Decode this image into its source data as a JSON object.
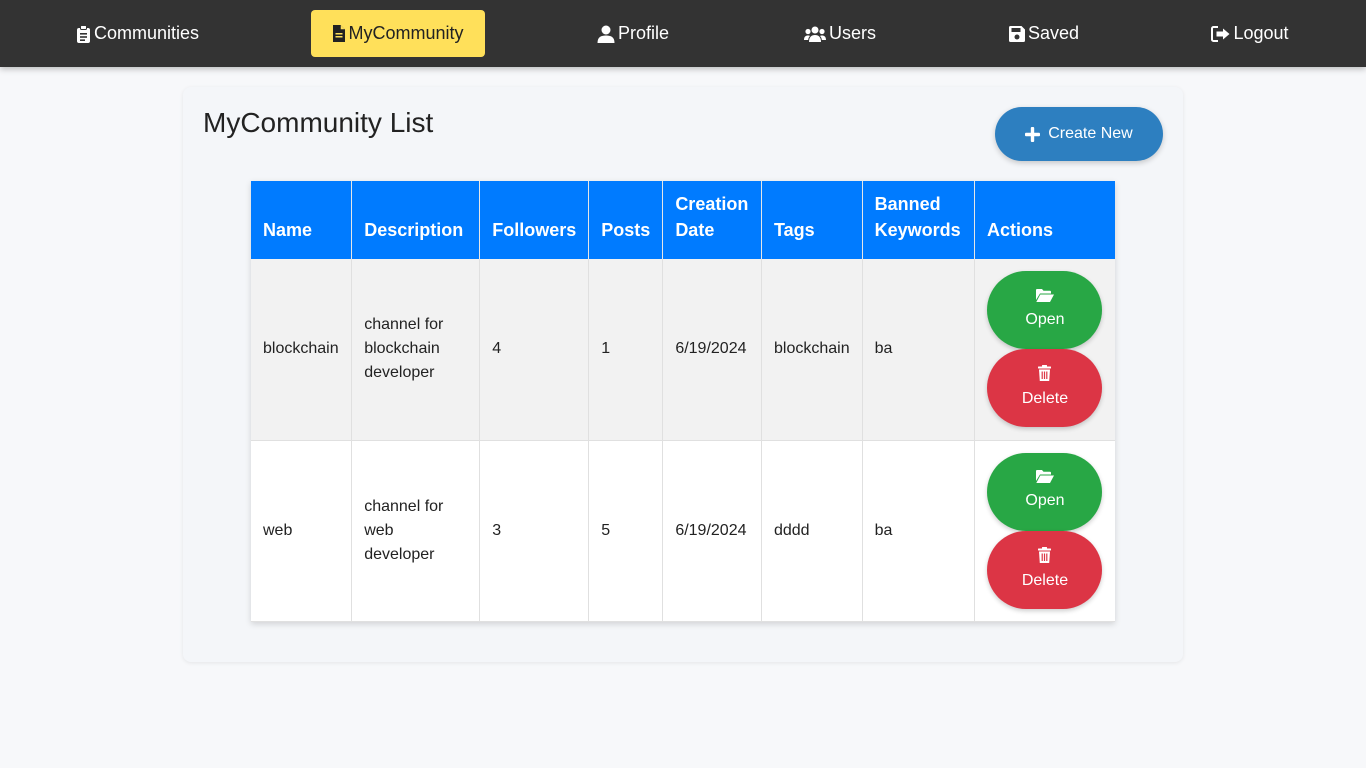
{
  "nav": {
    "items": [
      {
        "label": "Communities",
        "icon": "clipboard-list-icon"
      },
      {
        "label": "MyCommunity",
        "icon": "file-icon",
        "active": true
      },
      {
        "label": "Profile",
        "icon": "user-icon"
      },
      {
        "label": "Users",
        "icon": "users-icon"
      },
      {
        "label": "Saved",
        "icon": "floppy-disk-icon"
      },
      {
        "label": "Logout",
        "icon": "sign-out-icon"
      }
    ],
    "active_color": "#ffe05a",
    "bar_color": "#333333"
  },
  "page": {
    "title": "MyCommunity List",
    "create_label": "Create New"
  },
  "table": {
    "headers": [
      "Name",
      "Description",
      "Followers",
      "Posts",
      "Creation Date",
      "Tags",
      "Banned Keywords",
      "Actions"
    ],
    "rows": [
      {
        "name": "blockchain",
        "description": "channel for blockchain developer",
        "followers": "4",
        "posts": "1",
        "creation_date": "6/19/2024",
        "tags": "blockchain",
        "banned": "ba",
        "open_label": "Open",
        "delete_label": "Delete"
      },
      {
        "name": "web",
        "description": "channel for web developer",
        "followers": "3",
        "posts": "5",
        "creation_date": "6/19/2024",
        "tags": "dddd",
        "banned": "ba",
        "open_label": "Open",
        "delete_label": "Delete"
      }
    ],
    "header_color": "#007bff"
  },
  "colors": {
    "open": "#28a745",
    "delete": "#dc3545",
    "create": "#2d7fc0"
  }
}
